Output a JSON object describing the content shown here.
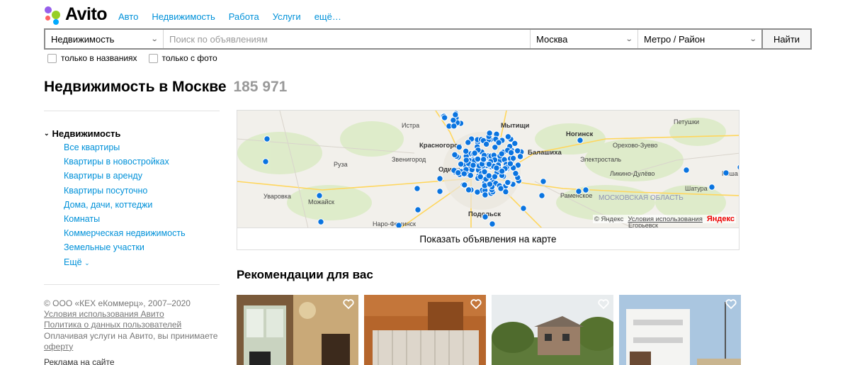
{
  "header": {
    "logo_text": "Avito",
    "nav": [
      "Авто",
      "Недвижимость",
      "Работа",
      "Услуги",
      "ещё…"
    ]
  },
  "search": {
    "category": "Недвижимость",
    "query_placeholder": "Поиск по объявлениям",
    "city": "Москва",
    "metro": "Метро / Район",
    "button": "Найти",
    "only_titles": "только в названиях",
    "only_photo": "только с фото"
  },
  "page": {
    "title": "Недвижимость в Москве",
    "count": "185 971"
  },
  "sidebar": {
    "heading": "Недвижимость",
    "items": [
      "Все квартиры",
      "Квартиры в новостройках",
      "Квартиры в аренду",
      "Квартиры посуточно",
      "Дома, дачи, коттеджи",
      "Комнаты",
      "Коммерческая недвижимость",
      "Земельные участки",
      "Ещё"
    ],
    "footer": {
      "copyright": "© ООО «КЕХ еКоммерц», 2007–2020",
      "terms": "Условия использования Авито",
      "privacy": "Политика о данных пользователей",
      "paid_prefix": "Оплачивая услуги на Авито, вы принимаете",
      "offer": "оферту",
      "ads": "Реклама на сайте"
    }
  },
  "map": {
    "labels": [
      "Истра",
      "Мытищи",
      "Ногинск",
      "Петушки",
      "Красногорск",
      "Балашиха",
      "Орехово-Зуево",
      "Руза",
      "Звенигород",
      "Одинц",
      "Электросталь",
      "Ликино-Дулёво",
      "Уваровка",
      "Можайск",
      "Шатура",
      "Подольск",
      "Раменское",
      "Наро-Фоминск",
      "Егорьевск",
      "Роша"
    ],
    "region": "МОСКОВСКАЯ ОБЛАСТЬ",
    "copyright": "© Яндекс",
    "terms": "Условия использования",
    "yandex": "Яндекс",
    "show_button": "Показать объявления на карте",
    "marker_color": "#0a74e0"
  },
  "recommendations": {
    "title": "Рекомендации для вас",
    "cards": [
      {
        "image": "apartment-room-chandelier-photo"
      },
      {
        "image": "empty-room-orange-walls-photo"
      },
      {
        "image": "old-house-with-trees-photo"
      },
      {
        "image": "white-modern-building-photo"
      }
    ]
  }
}
